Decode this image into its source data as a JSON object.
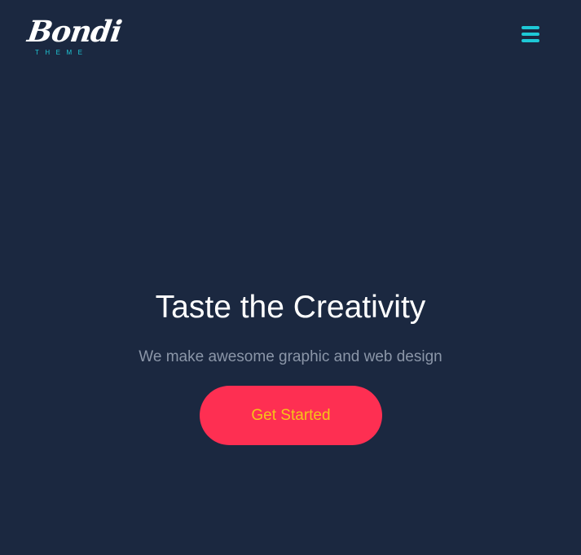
{
  "header": {
    "logo": {
      "script_text": "Bondi",
      "sub_text": "THEME"
    },
    "menu_icon": "hamburger-menu-icon"
  },
  "hero": {
    "title": "Taste the Creativity",
    "subtitle": "We make awesome graphic and web design",
    "cta_label": "Get Started"
  },
  "colors": {
    "background": "#1b2840",
    "accent_teal": "#1ec8d6",
    "cta_background": "#fe2f52",
    "cta_text": "#f5c518",
    "title_text": "#ffffff",
    "subtitle_text": "#8b96a8"
  }
}
